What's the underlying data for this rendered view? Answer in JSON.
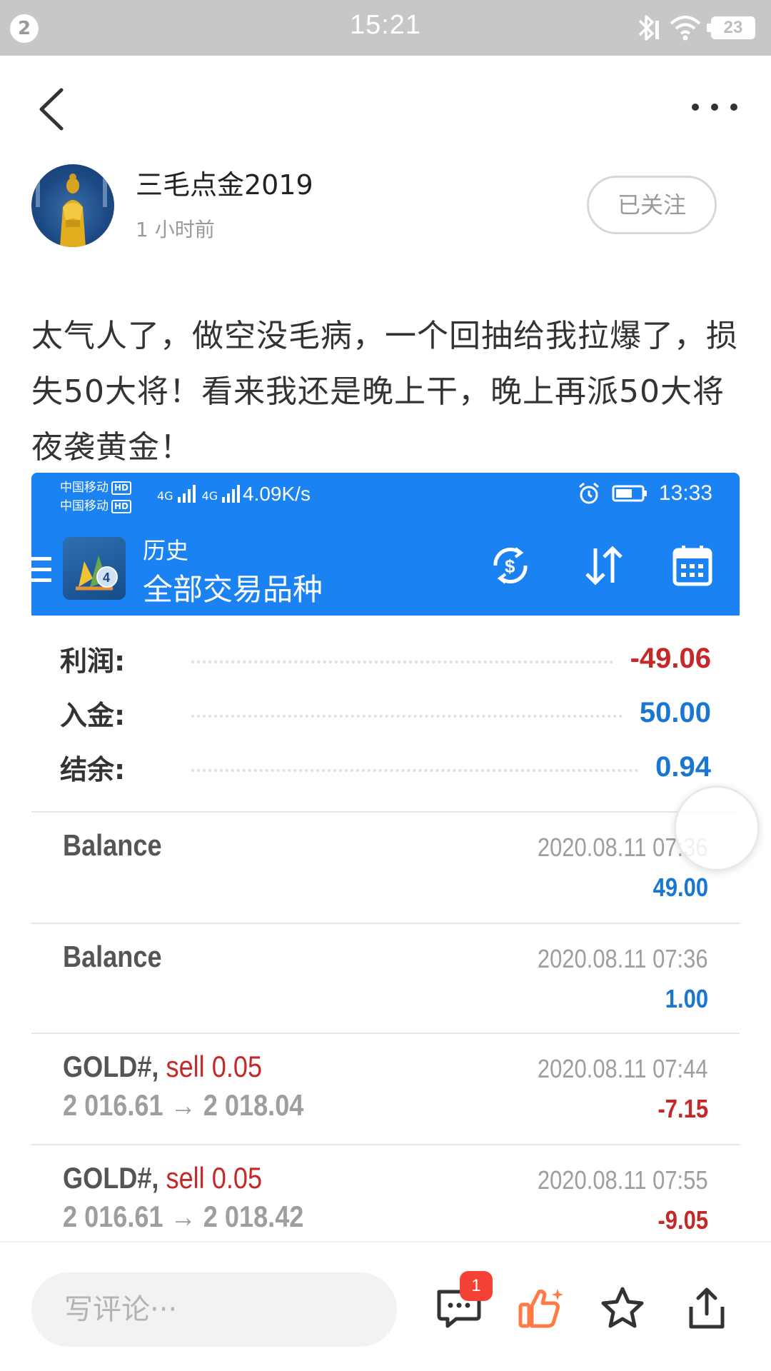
{
  "status_bar": {
    "notification_count": "2",
    "time": "15:21",
    "battery": "23",
    "icons": [
      "bluetooth-icon",
      "wifi-icon",
      "battery-icon"
    ]
  },
  "nav": {
    "back_icon": "chevron-left-icon",
    "more_icon": "more-horizontal-icon"
  },
  "author": {
    "name": "三毛点金2019",
    "time": "1 小时前",
    "follow_label": "已关注"
  },
  "post": {
    "text": "太气人了，做空没毛病，一个回抽给我拉爆了，损失50大将！看来我还是晚上干，晚上再派50大将夜袭黄金！"
  },
  "screenshot": {
    "status": {
      "carrier1": "中国移动",
      "carrier2": "中国移动",
      "hd": "HD",
      "net1": "4G",
      "net2": "4G",
      "speed": "4.09K/s",
      "time": "13:33"
    },
    "header": {
      "title": "历史",
      "subtitle": "全部交易品种"
    },
    "summary": [
      {
        "label": "利润:",
        "value": "-49.06",
        "color": "#c62828"
      },
      {
        "label": "入金:",
        "value": "50.00",
        "color": "#1976d2"
      },
      {
        "label": "结余:",
        "value": "0.94",
        "color": "#1976d2"
      }
    ],
    "deals": [
      {
        "name": "Balance",
        "side": "",
        "prices": "",
        "date": "2020.08.11 07:36",
        "amount": "49.00",
        "amount_color": "#1976d2"
      },
      {
        "name": "Balance",
        "side": "",
        "prices": "",
        "date": "2020.08.11 07:36",
        "amount": "1.00",
        "amount_color": "#1976d2"
      },
      {
        "name": "GOLD#, ",
        "side": "sell 0.05",
        "prices": "2 016.61 → 2 018.04",
        "date": "2020.08.11 07:44",
        "amount": "-7.15",
        "amount_color": "#c62828"
      },
      {
        "name": "GOLD#, ",
        "side": "sell 0.05",
        "prices": "2 016.61 → 2 018.42",
        "date": "2020.08.11 07:55",
        "amount": "-9.05",
        "amount_color": "#c62828"
      }
    ]
  },
  "bottom_bar": {
    "comment_placeholder": "写评论···",
    "comment_badge": "1",
    "icons": [
      "comment-icon",
      "like-icon",
      "star-icon",
      "share-icon"
    ],
    "like_color": "#ff7a45"
  }
}
